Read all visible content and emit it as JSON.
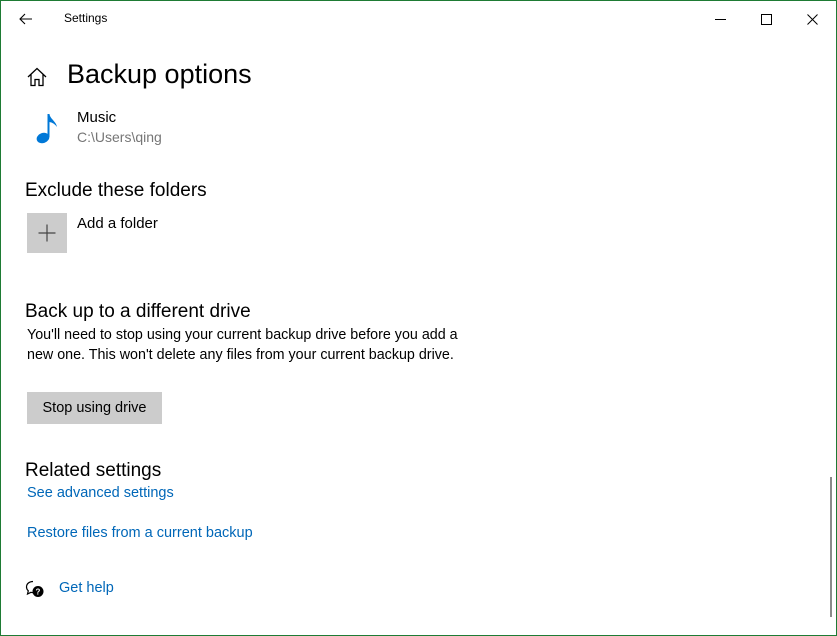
{
  "window": {
    "title": "Settings",
    "back_icon": "back-arrow-icon",
    "controls": [
      "minimize-icon",
      "maximize-icon",
      "close-icon"
    ]
  },
  "page": {
    "title": "Backup options",
    "home_icon": "home-icon"
  },
  "backup_folder": {
    "icon": "music-note-icon",
    "icon_color": "#0078d7",
    "name": "Music",
    "path": "C:\\Users\\qing"
  },
  "exclude": {
    "heading": "Exclude these folders",
    "add_label": "Add a folder",
    "add_icon": "plus-icon"
  },
  "different_drive": {
    "heading": "Back up to a different drive",
    "description": "You'll need to stop using your current backup drive before you add a new one. This won't delete any files from your current backup drive.",
    "button_label": "Stop using drive"
  },
  "related": {
    "heading": "Related settings",
    "links": [
      "See advanced settings",
      "Restore files from a current backup"
    ]
  },
  "help": {
    "icon": "help-chat-icon",
    "label": "Get help"
  },
  "colors": {
    "accent": "#0067b8",
    "border": "#1e7b34",
    "tile": "#cccccc"
  }
}
